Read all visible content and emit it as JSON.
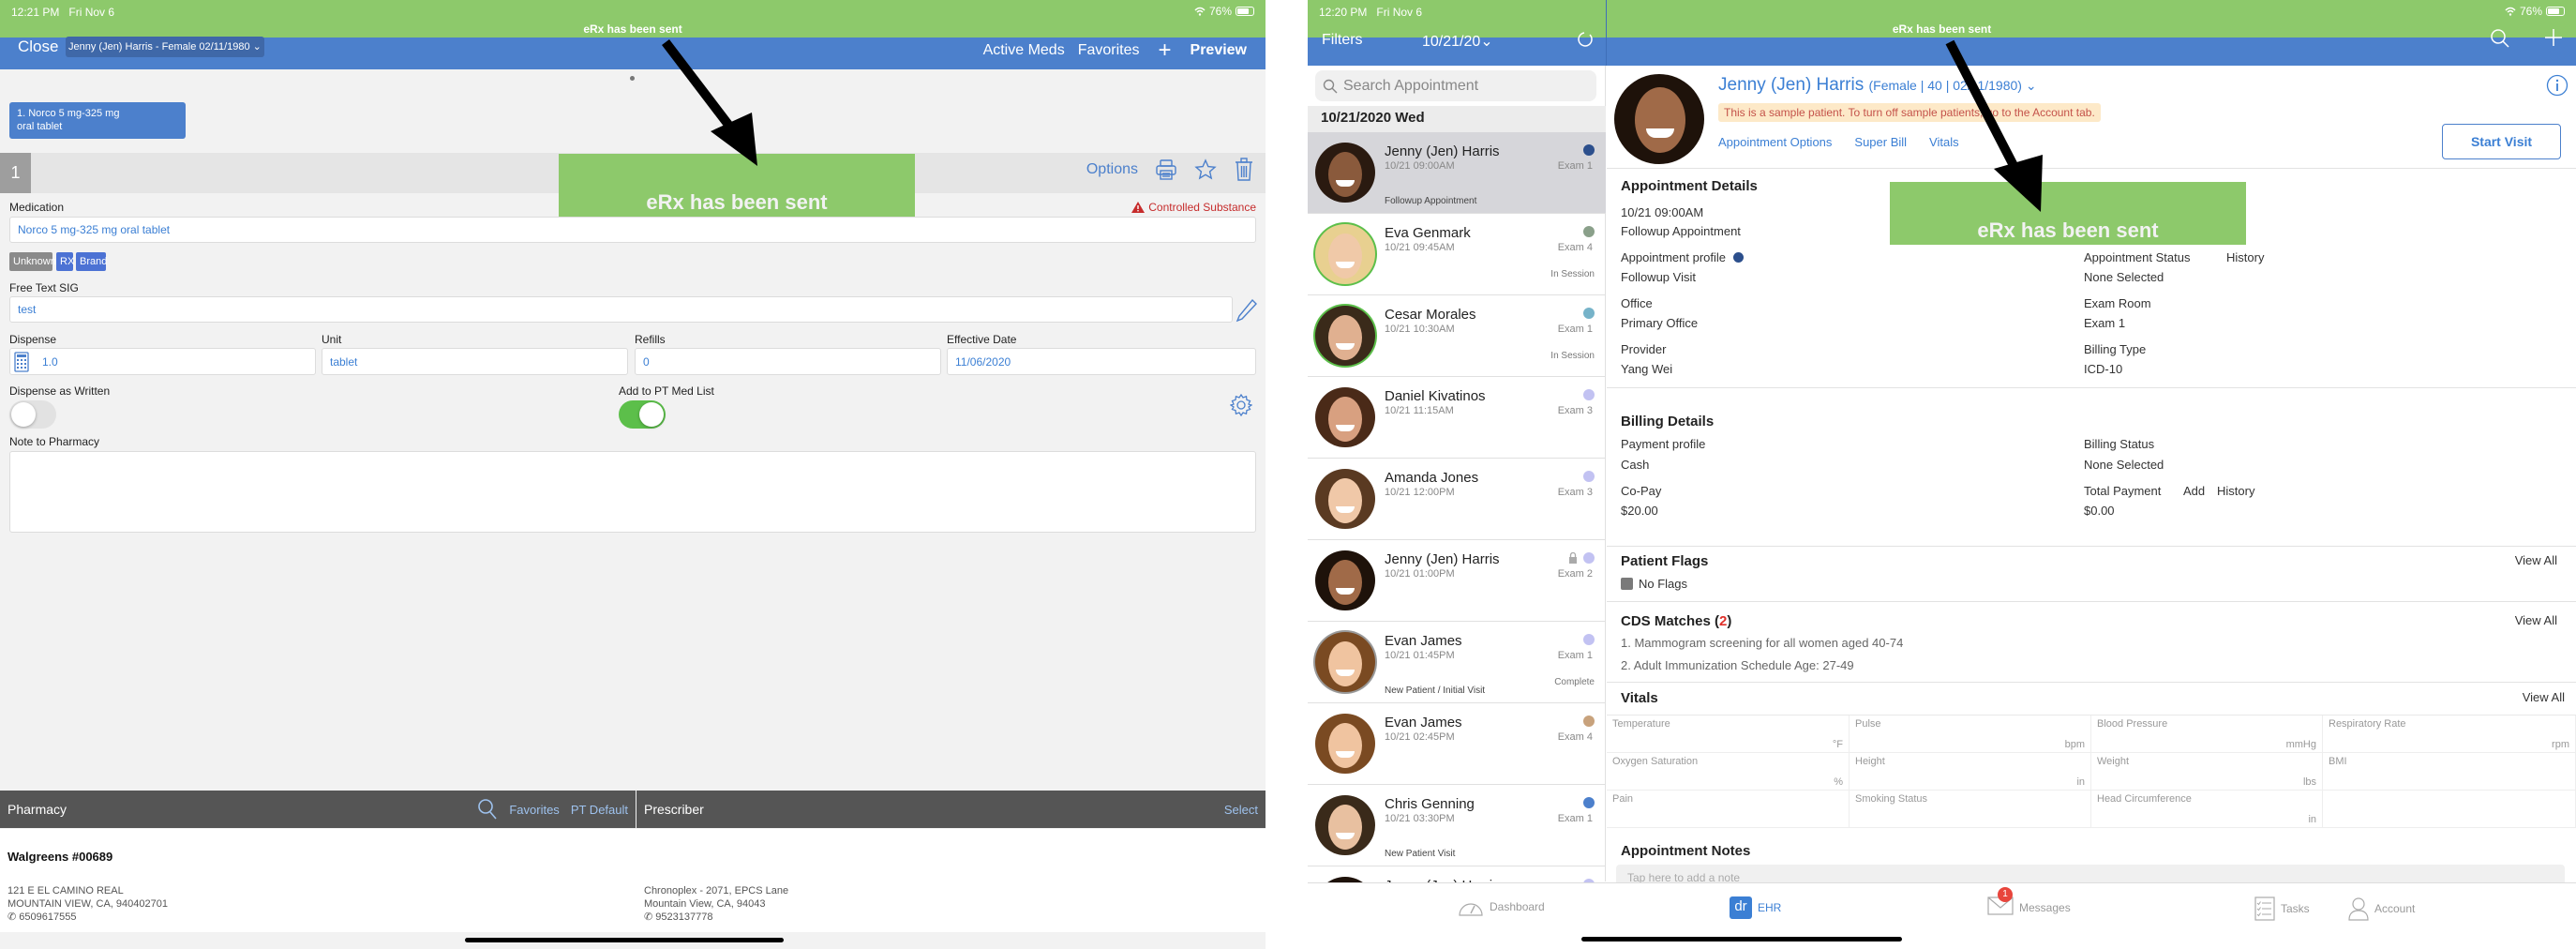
{
  "left": {
    "status": {
      "time": "12:21 PM",
      "date": "Fri Nov 6",
      "battery": "76%",
      "banner": "eRx has been sent"
    },
    "nav": {
      "close": "Close",
      "patient": "Jenny (Jen) Harris - Female 02/11/1980 ⌄",
      "active_meds": "Active Meds",
      "favorites": "Favorites",
      "add": "+",
      "preview": "Preview"
    },
    "med_chip": {
      "line1": "1. Norco 5 mg-325 mg",
      "line2": "oral tablet"
    },
    "rx_number": "1",
    "toast": "eRx has been sent",
    "options": "Options",
    "controlled": "Controlled Substance",
    "medication": {
      "label": "Medication",
      "value": "Norco 5 mg-325 mg oral tablet"
    },
    "tags": [
      {
        "label": "Unknown",
        "color": "#8a8a8a"
      },
      {
        "label": "RX",
        "color": "#4c72d4"
      },
      {
        "label": "Brand",
        "color": "#4c72d4"
      }
    ],
    "sig": {
      "label": "Free Text SIG",
      "value": "test"
    },
    "dispense": {
      "label": "Dispense",
      "value": "1.0"
    },
    "unit": {
      "label": "Unit",
      "value": "tablet"
    },
    "refills": {
      "label": "Refills",
      "value": "0"
    },
    "effective_date": {
      "label": "Effective Date",
      "value": "11/06/2020"
    },
    "daw": {
      "label": "Dispense as Written",
      "on": false
    },
    "add_pt": {
      "label": "Add to PT Med List",
      "on": true
    },
    "note": {
      "label": "Note to Pharmacy",
      "value": ""
    },
    "pharmacy": {
      "header": "Pharmacy",
      "favorites": "Favorites",
      "pt_default": "PT Default",
      "name": "Walgreens #00689",
      "address1": "121 E EL CAMINO REAL",
      "address2": "MOUNTAIN VIEW, CA, 940402701",
      "phone": "6509617555"
    },
    "prescriber": {
      "header": "Prescriber",
      "select": "Select",
      "address1": "Chronoplex - 2071, EPCS Lane",
      "address2": "Mountain View, CA, 94043",
      "phone": "9523137778"
    }
  },
  "right": {
    "status": {
      "time": "12:20 PM",
      "date": "Fri Nov 6",
      "battery": "76%",
      "banner": "eRx has been sent"
    },
    "nav": {
      "filters": "Filters",
      "date": "10/21/20⌄"
    },
    "search_placeholder": "Search Appointment",
    "date_header": "10/21/2020 Wed",
    "appointments": [
      {
        "name": "Jenny (Jen) Harris",
        "time": "10/21 09:00AM",
        "room": "Exam 1",
        "status": "",
        "type": "Followup Appointment",
        "dot": "#2c4f8c",
        "ring": "",
        "selected": true,
        "lock": false,
        "skin": "#8a5a3c",
        "hair": "#2a1a10"
      },
      {
        "name": "Eva Genmark",
        "time": "10/21 09:45AM",
        "room": "Exam 4",
        "status": "In Session",
        "type": "",
        "dot": "#8aa08a",
        "ring": "green",
        "selected": false,
        "lock": false,
        "skin": "#f0c9a8",
        "hair": "#e8d090"
      },
      {
        "name": "Cesar Morales",
        "time": "10/21 10:30AM",
        "room": "Exam 1",
        "status": "In Session",
        "type": "",
        "dot": "#76b3c9",
        "ring": "green",
        "selected": false,
        "lock": false,
        "skin": "#e0b090",
        "hair": "#3a2a1a"
      },
      {
        "name": "Daniel Kivatinos",
        "time": "10/21 11:15AM",
        "room": "Exam 3",
        "status": "",
        "type": "",
        "dot": "#c2c2f2",
        "ring": "",
        "selected": false,
        "lock": false,
        "skin": "#d8a080",
        "hair": "#4a2a18"
      },
      {
        "name": "Amanda Jones",
        "time": "10/21 12:00PM",
        "room": "Exam 3",
        "status": "",
        "type": "",
        "dot": "#c2c2f2",
        "ring": "",
        "selected": false,
        "lock": false,
        "skin": "#f0c8a8",
        "hair": "#5a3a22"
      },
      {
        "name": "Jenny (Jen) Harris",
        "time": "10/21 01:00PM",
        "room": "Exam 2",
        "status": "",
        "type": "",
        "dot": "#c2c2f2",
        "ring": "",
        "selected": false,
        "lock": true,
        "skin": "#a06a48",
        "hair": "#1e120a"
      },
      {
        "name": "Evan James",
        "time": "10/21 01:45PM",
        "room": "Exam 1",
        "status": "Complete",
        "type": "New Patient / Initial Visit",
        "dot": "#c2c2f2",
        "ring": "gray",
        "selected": false,
        "lock": false,
        "skin": "#f0c4a0",
        "hair": "#7a4a22"
      },
      {
        "name": "Evan James",
        "time": "10/21 02:45PM",
        "room": "Exam 4",
        "status": "",
        "type": "",
        "dot": "#c8a27c",
        "ring": "",
        "selected": false,
        "lock": false,
        "skin": "#f0c4a0",
        "hair": "#7a4a22"
      },
      {
        "name": "Chris Genning",
        "time": "10/21 03:30PM",
        "room": "Exam 1",
        "status": "",
        "type": "New Patient Visit",
        "dot": "#4c80cc",
        "ring": "",
        "selected": false,
        "lock": false,
        "skin": "#e8c0a0",
        "hair": "#3a2a1a"
      },
      {
        "name": "Jenny (Jen) Harris",
        "time": "",
        "room": "",
        "status": "",
        "type": "",
        "dot": "#c2c2f2",
        "ring": "",
        "selected": false,
        "lock": false,
        "skin": "#a06a48",
        "hair": "#1e120a"
      }
    ],
    "patient": {
      "name": "Jenny (Jen) Harris",
      "details": "(Female | 40 | 02/11/1980) ⌄",
      "sample_notice": "This is a sample patient. To turn off sample patients, go to the Account tab."
    },
    "links": {
      "appointment_options": "Appointment Options",
      "super_bill": "Super Bill",
      "vitals": "Vitals",
      "start_visit": "Start Visit"
    },
    "toast": "eRx has been sent",
    "appointment_details": {
      "title": "Appointment Details",
      "time": "10/21 09:00AM",
      "type": "Followup Appointment",
      "profile_label": "Appointment profile",
      "profile_value": "Followup Visit",
      "office_label": "Office",
      "office_value": "Primary Office",
      "provider_label": "Provider",
      "provider_value": "Yang Wei",
      "status_label": "Appointment Status",
      "status_history": "History",
      "status_value": "None Selected",
      "room_label": "Exam Room",
      "room_value": "Exam 1",
      "billing_type_label": "Billing Type",
      "billing_type_value": "ICD-10"
    },
    "billing_details": {
      "title": "Billing Details",
      "payment_profile_label": "Payment profile",
      "payment_profile_value": "Cash",
      "copay_label": "Co-Pay",
      "copay_value": "$20.00",
      "billing_status_label": "Billing Status",
      "billing_status_value": "None Selected",
      "total_label": "Total Payment",
      "total_add": "Add",
      "total_history": "History",
      "total_value": "$0.00"
    },
    "flags": {
      "title": "Patient Flags",
      "view_all": "View All",
      "value": "No Flags"
    },
    "cds": {
      "title": "CDS Matches (",
      "count": "2",
      "close": ")",
      "view_all": "View All",
      "items": [
        "1. Mammogram screening for all women aged 40-74",
        "2. Adult Immunization Schedule Age: 27-49"
      ]
    },
    "vitals": {
      "title": "Vitals",
      "view_all": "View All",
      "cells": [
        {
          "label": "Temperature",
          "unit": "°F"
        },
        {
          "label": "Pulse",
          "unit": "bpm"
        },
        {
          "label": "Blood Pressure",
          "unit": "mmHg"
        },
        {
          "label": "Respiratory Rate",
          "unit": "rpm"
        },
        {
          "label": "Oxygen Saturation",
          "unit": "%"
        },
        {
          "label": "Height",
          "unit": "in"
        },
        {
          "label": "Weight",
          "unit": "lbs"
        },
        {
          "label": "BMI",
          "unit": ""
        },
        {
          "label": "Pain",
          "unit": ""
        },
        {
          "label": "Smoking Status",
          "unit": ""
        },
        {
          "label": "Head Circumference",
          "unit": "in"
        },
        {
          "label": "",
          "unit": ""
        }
      ]
    },
    "notes": {
      "title": "Appointment Notes",
      "placeholder": "Tap here to add a note"
    },
    "tabs": [
      {
        "label": "Dashboard",
        "icon": "dashboard-icon",
        "active": false
      },
      {
        "label": "EHR",
        "icon": "ehr-icon",
        "active": true
      },
      {
        "label": "Messages",
        "icon": "messages-icon",
        "active": false,
        "badge": "1"
      },
      {
        "label": "Tasks",
        "icon": "tasks-icon",
        "active": false
      },
      {
        "label": "Account",
        "icon": "account-icon",
        "active": false
      }
    ]
  }
}
